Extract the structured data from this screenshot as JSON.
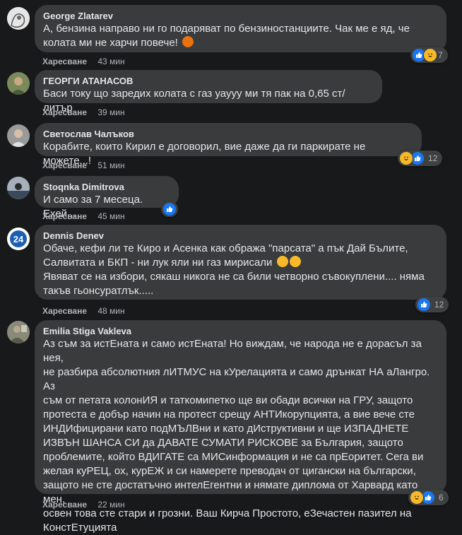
{
  "comments": [
    {
      "author": "George Zlatarev",
      "text": "А, бензина направо ни го подаряват по бензиностанциите. Чак ме е яд, че колата ми не харчи повече!",
      "like_label": "Харесване",
      "time": "43 мин",
      "reaction_count": "7",
      "reactions": [
        "like-icon",
        "haha-icon"
      ]
    },
    {
      "author": "ГЕОРГИ АТАНАСОВ",
      "text": "Баси току що заредих колата с газ уаууу ми тя пак на 0,65 ст/литър",
      "like_label": "Харесване",
      "time": "39 мин"
    },
    {
      "author": "Светослав Чалъков",
      "text": "Корабите, които Кирил е договорил, вие даже да ги паркирате не можете...!",
      "like_label": "Харесване",
      "time": "51 мин",
      "reaction_count": "12",
      "reactions": [
        "haha-icon",
        "like-icon"
      ]
    },
    {
      "author": "Stoqnka Dimitrova",
      "text": "И само за 7 месеца. Ехей...",
      "like_label": "Харесване",
      "time": "45 мин",
      "reactions": [
        "like-icon"
      ]
    },
    {
      "author": "Dennis Denev",
      "text_lines": [
        "Обаче, кефи ли те Киро и Асенка как обража \"парсата\" а пък Дай Бълите,",
        "Салвитата и БКП - ни лук яли ни газ мирисали",
        "Явяват се на избори, сякаш никога не са били четворно съвокуплени.... няма",
        "такъв гьонсуратлък....."
      ],
      "like_label": "Харесване",
      "time": "48 мин",
      "reaction_count": "12",
      "reactions": [
        "like-icon"
      ],
      "avatar_label": "24"
    },
    {
      "author": "Emilia Stiga Vakleva",
      "text_lines": [
        "Аз съм за истЕната и само истЕната! Но виждам, че народа не е дорасъл за нея,",
        "не разбира абсолютния лИТМУС на кУрелацията и само дрънкат НА аЛангро. Аз",
        "съм от петата колонИЯ и таткомипетко ще ви обади всички на ГРУ, защото",
        "протеста е добър начин на протест срещу АНТИкорупцията, а вие вече сте",
        "ИНДИфицирани като подМЪЛВни и като дИструктивни и ще ИЗПАДНЕТЕ",
        "ИЗВЪН ШАНСА СИ да ДАВАТЕ СУМАТИ РИСКОВЕ за България, защото",
        "проблемите, който ВДИГАТЕ са МИСинформация и не са прЕоритет. Сега ви",
        "желая куРЕЦ, ох, курЕЖ и си намерете преводач от цигански на български,",
        "защото не сте достатъчно интелЕгентни и нямате диплома от Харвард като мен,",
        "освен това сте стари и грозни. Ваш Кирча Простото, еЗечастен пазител на",
        "КонстЕтуцията"
      ],
      "like_label": "Харесване",
      "time": "22 мин",
      "reaction_count": "6",
      "reactions": [
        "haha-icon",
        "like-icon"
      ]
    }
  ],
  "colors": {
    "background": "#18191a",
    "bubble": "#3a3b3c",
    "text": "#e4e6eb",
    "secondary": "#b0b3b8",
    "like_blue": "#1877f2",
    "haha_yellow": "#f7b928"
  }
}
